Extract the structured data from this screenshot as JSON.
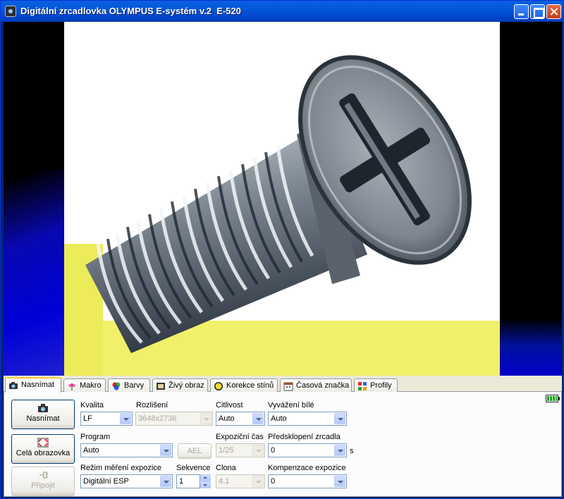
{
  "window": {
    "title": "Digitální zrcadlovka OLYMPUS E-systém v.2  E-520"
  },
  "tabs": [
    {
      "label": "Nasnímat",
      "icon": "camera-icon",
      "active": true
    },
    {
      "label": "Makro",
      "icon": "flower-icon",
      "active": false
    },
    {
      "label": "Barvy",
      "icon": "colors-icon",
      "active": false
    },
    {
      "label": "Živý obraz",
      "icon": "film-icon",
      "active": false
    },
    {
      "label": "Korekce stínů",
      "icon": "shading-icon",
      "active": false
    },
    {
      "label": "Časová značka",
      "icon": "calendar-icon",
      "active": false
    },
    {
      "label": "Profily",
      "icon": "profiles-icon",
      "active": false
    }
  ],
  "buttons": {
    "capture": "Nasnímat",
    "fullscreen": "Celá obrazovka",
    "connect": "Připojit",
    "ael": "AEL"
  },
  "fields": {
    "quality": {
      "label": "Kvalita",
      "value": "LF"
    },
    "resolution": {
      "label": "Rozlišení",
      "value": "3648x2736"
    },
    "sensitivity": {
      "label": "Citlivost",
      "value": "Auto"
    },
    "white_balance": {
      "label": "Vyvážení bílé",
      "value": "Auto"
    },
    "program": {
      "label": "Program",
      "value": "Auto"
    },
    "exposure_time": {
      "label": "Expoziční čas",
      "value": "1/25"
    },
    "mirror_prelift": {
      "label": "Předsklopení zrcadla",
      "value": "0",
      "unit": "s"
    },
    "metering": {
      "label": "Režim měření expozice",
      "value": "Digitální ESP"
    },
    "sequence": {
      "label": "Sekvence",
      "value": "1"
    },
    "aperture": {
      "label": "Clona",
      "value": "4.1"
    },
    "exposure_comp": {
      "label": "Kompenzace expozice",
      "value": "0"
    }
  },
  "colors": {
    "titlebar": "#0054e3",
    "tab_highlight": "#ffc83c",
    "battery": "#1ea01e"
  }
}
